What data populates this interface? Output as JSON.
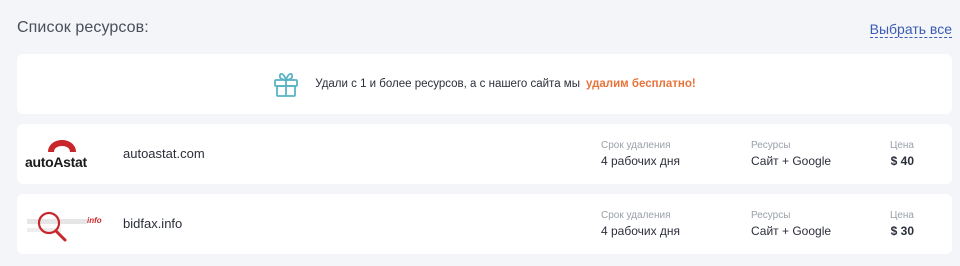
{
  "header": {
    "title": "Список ресурсов:",
    "select_all": "Выбрать все"
  },
  "promo": {
    "icon": "gift-icon",
    "text": "Удали с 1 и более ресурсов, а с нашего сайта мы",
    "highlight": "удалим бесплатно!",
    "highlight_color": "#e8743b"
  },
  "columns": {
    "time_label": "Срок удаления",
    "resources_label": "Ресурсы",
    "price_label": "Цена"
  },
  "resources": [
    {
      "logo": "autoastat-logo",
      "logo_text": "autoAstat",
      "domain": "autoastat.com",
      "time": "4 рабочих дня",
      "resources": "Сайт + Google",
      "price": "$ 40"
    },
    {
      "logo": "bidfax-logo",
      "logo_text": "info",
      "domain": "bidfax.info",
      "time": "4 рабочих дня",
      "resources": "Сайт + Google",
      "price": "$ 30"
    }
  ],
  "colors": {
    "accent": "#e8743b",
    "link": "#3a5bb5",
    "gift_icon": "#5ab3c4",
    "logo_red": "#c8262b"
  }
}
